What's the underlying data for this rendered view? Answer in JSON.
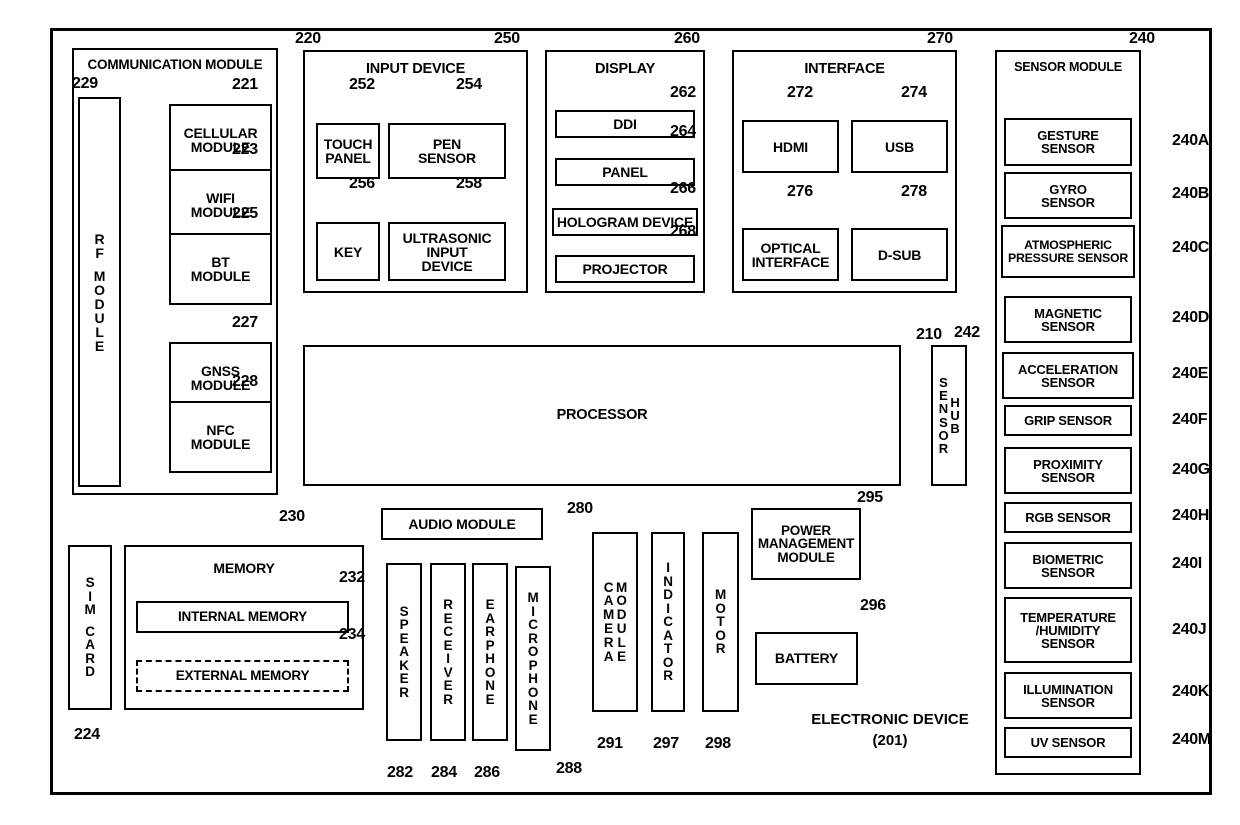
{
  "figure": {
    "device_caption_line1": "ELECTRONIC DEVICE",
    "device_caption_line2": "(201)",
    "outer_ref": "201"
  },
  "communication_module": {
    "title": "COMMUNICATION MODULE",
    "ref": "220",
    "rf_module": {
      "label": "RF MODULE",
      "ref": "229",
      "letters": [
        "R",
        "F",
        "",
        "M",
        "O",
        "D",
        "U",
        "L",
        "E"
      ]
    },
    "submodules": [
      {
        "label_line1": "CELLULAR",
        "label_line2": "MODULE",
        "ref": "221"
      },
      {
        "label_line1": "WIFI",
        "label_line2": "MODULE",
        "ref": "223"
      },
      {
        "label_line1": "BT",
        "label_line2": "MODULE",
        "ref": "225"
      },
      {
        "label_line1": "GNSS",
        "label_line2": "MODULE",
        "ref": "227"
      },
      {
        "label_line1": "NFC",
        "label_line2": "MODULE",
        "ref": "228"
      }
    ]
  },
  "input_device": {
    "title": "INPUT DEVICE",
    "ref": "250",
    "items": [
      {
        "label_line1": "TOUCH",
        "label_line2": "PANEL",
        "label_line3": "",
        "ref": "252"
      },
      {
        "label_line1": "PEN",
        "label_line2": "SENSOR",
        "label_line3": "",
        "ref": "254"
      },
      {
        "label_line1": "KEY",
        "label_line2": "",
        "label_line3": "",
        "ref": "256"
      },
      {
        "label_line1": "ULTRASONIC",
        "label_line2": "INPUT",
        "label_line3": "DEVICE",
        "ref": "258"
      }
    ]
  },
  "display": {
    "title": "DISPLAY",
    "ref": "260",
    "items": [
      {
        "label": "DDI",
        "ref": "262"
      },
      {
        "label": "PANEL",
        "ref": "264"
      },
      {
        "label": "HOLOGRAM DEVICE",
        "ref": "266"
      },
      {
        "label": "PROJECTOR",
        "ref": "268"
      }
    ]
  },
  "interface": {
    "title": "INTERFACE",
    "ref": "270",
    "items": [
      {
        "label_line1": "HDMI",
        "label_line2": "",
        "ref": "272"
      },
      {
        "label_line1": "USB",
        "label_line2": "",
        "ref": "274"
      },
      {
        "label_line1": "OPTICAL",
        "label_line2": "INTERFACE",
        "ref": "276"
      },
      {
        "label_line1": "D-SUB",
        "label_line2": "",
        "ref": "278"
      }
    ]
  },
  "sensor_module": {
    "title": "SENSOR MODULE",
    "ref": "240",
    "items": [
      {
        "label_line1": "GESTURE",
        "label_line2": "SENSOR",
        "label_line3": "",
        "ref": "240A"
      },
      {
        "label_line1": "GYRO",
        "label_line2": "SENSOR",
        "label_line3": "",
        "ref": "240B"
      },
      {
        "label_line1": "ATMOSPHERIC",
        "label_line2": "PRESSURE SENSOR",
        "label_line3": "",
        "ref": "240C"
      },
      {
        "label_line1": "MAGNETIC",
        "label_line2": "SENSOR",
        "label_line3": "",
        "ref": "240D"
      },
      {
        "label_line1": "ACCELERATION",
        "label_line2": "SENSOR",
        "label_line3": "",
        "ref": "240E"
      },
      {
        "label_line1": "GRIP SENSOR",
        "label_line2": "",
        "label_line3": "",
        "ref": "240F"
      },
      {
        "label_line1": "PROXIMITY",
        "label_line2": "SENSOR",
        "label_line3": "",
        "ref": "240G"
      },
      {
        "label_line1": "RGB SENSOR",
        "label_line2": "",
        "label_line3": "",
        "ref": "240H"
      },
      {
        "label_line1": "BIOMETRIC",
        "label_line2": "SENSOR",
        "label_line3": "",
        "ref": "240I"
      },
      {
        "label_line1": "TEMPERATURE",
        "label_line2": "/HUMIDITY",
        "label_line3": "SENSOR",
        "ref": "240J"
      },
      {
        "label_line1": "ILLUMINATION",
        "label_line2": "SENSOR",
        "label_line3": "",
        "ref": "240K"
      },
      {
        "label_line1": "UV SENSOR",
        "label_line2": "",
        "label_line3": "",
        "ref": "240M"
      }
    ]
  },
  "processor": {
    "label": "PROCESSOR",
    "ref": "210"
  },
  "sensor_hub": {
    "label": "SENSOR HUB",
    "ref": "242",
    "col1": [
      "S",
      "E",
      "N",
      "S",
      "O",
      "R"
    ],
    "col2": [
      "H",
      "U",
      "B"
    ]
  },
  "sim_card": {
    "label": "SIM CARD",
    "ref": "224",
    "letters": [
      "S",
      "I",
      "M",
      "",
      "C",
      "A",
      "R",
      "D"
    ]
  },
  "memory": {
    "title": "MEMORY",
    "ref": "230",
    "internal": {
      "label": "INTERNAL MEMORY",
      "ref": "232"
    },
    "external": {
      "label": "EXTERNAL MEMORY",
      "ref": "234"
    }
  },
  "audio": {
    "module": {
      "label": "AUDIO MODULE",
      "ref": "280"
    },
    "devices": [
      {
        "label": "SPEAKER",
        "ref": "282",
        "letters": [
          "S",
          "P",
          "E",
          "A",
          "K",
          "E",
          "R"
        ]
      },
      {
        "label": "RECEIVER",
        "ref": "284",
        "letters": [
          "R",
          "E",
          "C",
          "E",
          "I",
          "V",
          "E",
          "R"
        ]
      },
      {
        "label": "EARPHONE",
        "ref": "286",
        "letters": [
          "E",
          "A",
          "R",
          "P",
          "H",
          "O",
          "N",
          "E"
        ]
      },
      {
        "label": "MICROPHONE",
        "ref": "288",
        "letters": [
          "M",
          "I",
          "C",
          "R",
          "O",
          "P",
          "H",
          "O",
          "N",
          "E"
        ]
      }
    ]
  },
  "camera": {
    "label": "CAMERA MODULE",
    "ref": "291",
    "col1": [
      "C",
      "A",
      "M",
      "E",
      "R",
      "A"
    ],
    "col2": [
      "M",
      "O",
      "D",
      "U",
      "L",
      "E"
    ]
  },
  "indicator": {
    "label": "INDICATOR",
    "ref": "297",
    "letters": [
      "I",
      "N",
      "D",
      "I",
      "C",
      "A",
      "T",
      "O",
      "R"
    ]
  },
  "motor": {
    "label": "MOTOR",
    "ref": "298",
    "letters": [
      "M",
      "O",
      "T",
      "O",
      "R"
    ]
  },
  "power_management": {
    "label_line1": "POWER",
    "label_line2": "MANAGEMENT",
    "label_line3": "MODULE",
    "ref": "295"
  },
  "battery": {
    "label": "BATTERY",
    "ref": "296"
  },
  "colors": {
    "ink": "#000000",
    "paper": "#ffffff"
  }
}
